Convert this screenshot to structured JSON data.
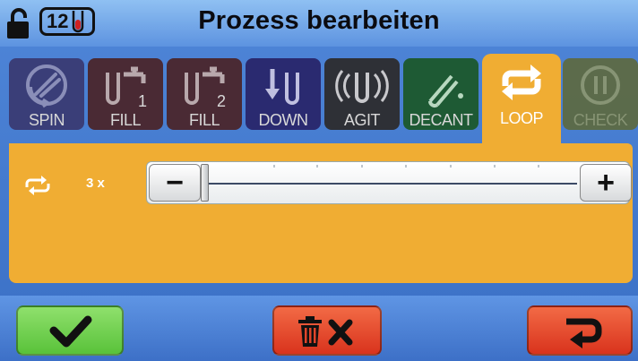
{
  "header": {
    "title": "Prozess bearbeiten",
    "tube_count": "12"
  },
  "tabs": [
    {
      "id": "spin",
      "label": "SPIN",
      "icon": "spin-icon",
      "active": false
    },
    {
      "id": "fill1",
      "label": "FILL",
      "icon": "fill-1-icon",
      "badge": "1",
      "active": false
    },
    {
      "id": "fill2",
      "label": "FILL",
      "icon": "fill-2-icon",
      "badge": "2",
      "active": false
    },
    {
      "id": "down",
      "label": "DOWN",
      "icon": "down-icon",
      "active": false
    },
    {
      "id": "agit",
      "label": "AGIT",
      "icon": "agit-icon",
      "active": false
    },
    {
      "id": "decant",
      "label": "DECANT",
      "icon": "decant-icon",
      "active": false
    },
    {
      "id": "loop",
      "label": "LOOP",
      "icon": "loop-icon",
      "active": true
    },
    {
      "id": "check",
      "label": "CHECK",
      "icon": "check-pause-icon",
      "active": false,
      "disabled": true
    }
  ],
  "loop_panel": {
    "icon": "loop-icon",
    "count_label": "3 x",
    "slider_value_fraction": 0.0,
    "minus_label": "−",
    "plus_label": "+"
  },
  "footer": {
    "ok_icon": "checkmark-icon",
    "delete_icon": "trash-x-icon",
    "back_icon": "return-arrow-icon"
  },
  "colors": {
    "accent": "#f0ad33",
    "background": "#4a7fd4",
    "ok_button": "#6cd04a",
    "delete_button": "#e8482c"
  }
}
